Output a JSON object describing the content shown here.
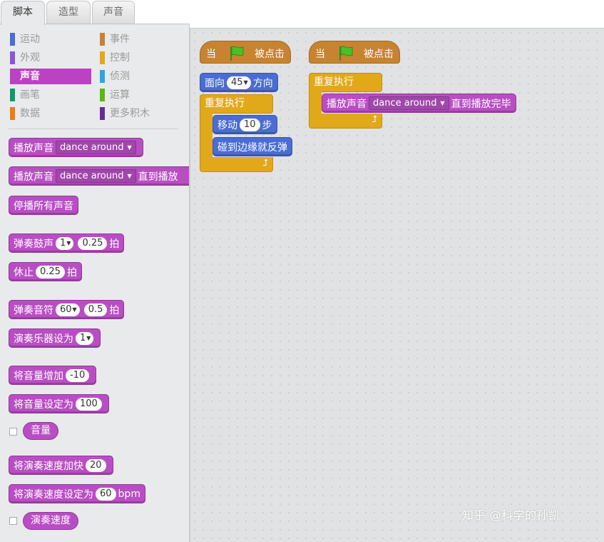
{
  "tabs": [
    {
      "label": "脚本"
    },
    {
      "label": "造型"
    },
    {
      "label": "声音"
    }
  ],
  "categories": [
    {
      "label": "运动",
      "color": "#4a6cd4"
    },
    {
      "label": "外观",
      "color": "#8a55d7"
    },
    {
      "label": "声音",
      "color": "#bb42c3"
    },
    {
      "label": "画笔",
      "color": "#0e9a6c"
    },
    {
      "label": "数据",
      "color": "#ee7d16"
    },
    {
      "label": "事件",
      "color": "#c88330"
    },
    {
      "label": "控制",
      "color": "#e1a91a"
    },
    {
      "label": "侦测",
      "color": "#2ca5e2"
    },
    {
      "label": "运算",
      "color": "#5cb712"
    },
    {
      "label": "更多积木",
      "color": "#632d99"
    }
  ],
  "palette": {
    "play_sound": "播放声音",
    "sound_name": "dance around",
    "play_sound_until": "播放声音",
    "until_done": "直到播放",
    "stop_all_sounds": "停播所有声音",
    "play_drum": "弹奏鼓声",
    "drum_num": "1",
    "drum_beats": "0.25",
    "beats": "拍",
    "rest": "休止",
    "rest_beats": "0.25",
    "rest_unit": "拍",
    "play_note": "弹奏音符",
    "note_num": "60",
    "note_beats": "0.5",
    "note_unit": "拍",
    "set_instrument": "演奏乐器设为",
    "instrument_num": "1",
    "change_volume": "将音量增加",
    "volume_delta": "-10",
    "set_volume": "将音量设定为",
    "volume_value": "100",
    "volume_reporter": "音量",
    "change_tempo": "将演奏速度加快",
    "tempo_delta": "20",
    "set_tempo": "将演奏速度设定为",
    "tempo_value": "60",
    "tempo_unit": "bpm",
    "tempo_reporter": "演奏速度"
  },
  "script1": {
    "hat_when": "当",
    "hat_clicked": "被点击",
    "point_dir": "面向",
    "dir_value": "45",
    "dir_suffix": "方向",
    "forever": "重复执行",
    "move": "移动",
    "move_steps": "10",
    "steps": "步",
    "bounce": "碰到边缘就反弹"
  },
  "script2": {
    "hat_when": "当",
    "hat_clicked": "被点击",
    "forever": "重复执行",
    "play_sound": "播放声音",
    "sound_name": "dance around",
    "until_done": "直到播放完毕"
  },
  "watermark": "知乎 @科学的孙凯"
}
